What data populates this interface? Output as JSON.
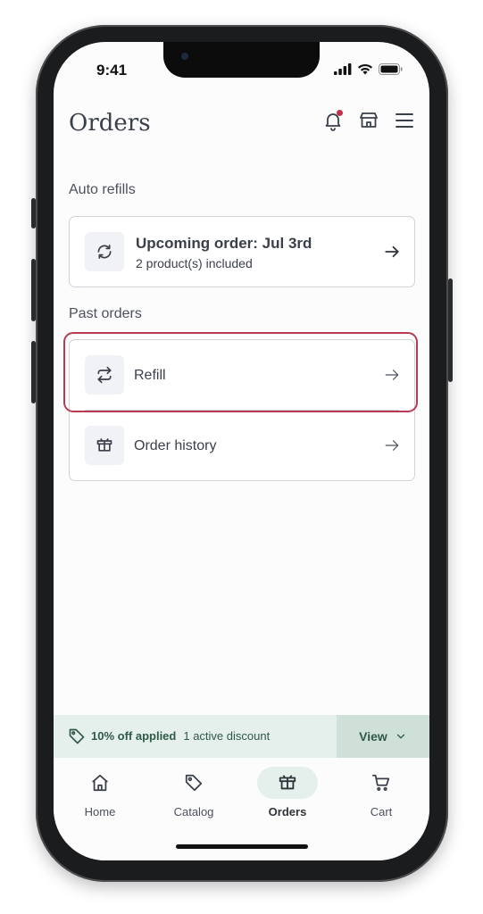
{
  "status_bar": {
    "time": "9:41"
  },
  "header": {
    "title": "Orders"
  },
  "auto_refills": {
    "section_label": "Auto refills",
    "card": {
      "title": "Upcoming order: Jul 3rd",
      "subtitle": "2 product(s) included"
    }
  },
  "past_orders": {
    "section_label": "Past orders",
    "items": [
      {
        "label": "Refill",
        "icon": "refill-icon"
      },
      {
        "label": "Order history",
        "icon": "box-icon"
      }
    ]
  },
  "discount": {
    "applied_label": "10% off applied",
    "detail": "1 active discount",
    "view_label": "View"
  },
  "tabs": [
    {
      "label": "Home",
      "icon": "home-icon",
      "active": false
    },
    {
      "label": "Catalog",
      "icon": "tag-icon",
      "active": false
    },
    {
      "label": "Orders",
      "icon": "box-icon",
      "active": true
    },
    {
      "label": "Cart",
      "icon": "cart-icon",
      "active": false
    }
  ],
  "colors": {
    "highlight": "#b83a55",
    "accent_green": "#2f5a47",
    "notification_dot": "#c0334c"
  }
}
